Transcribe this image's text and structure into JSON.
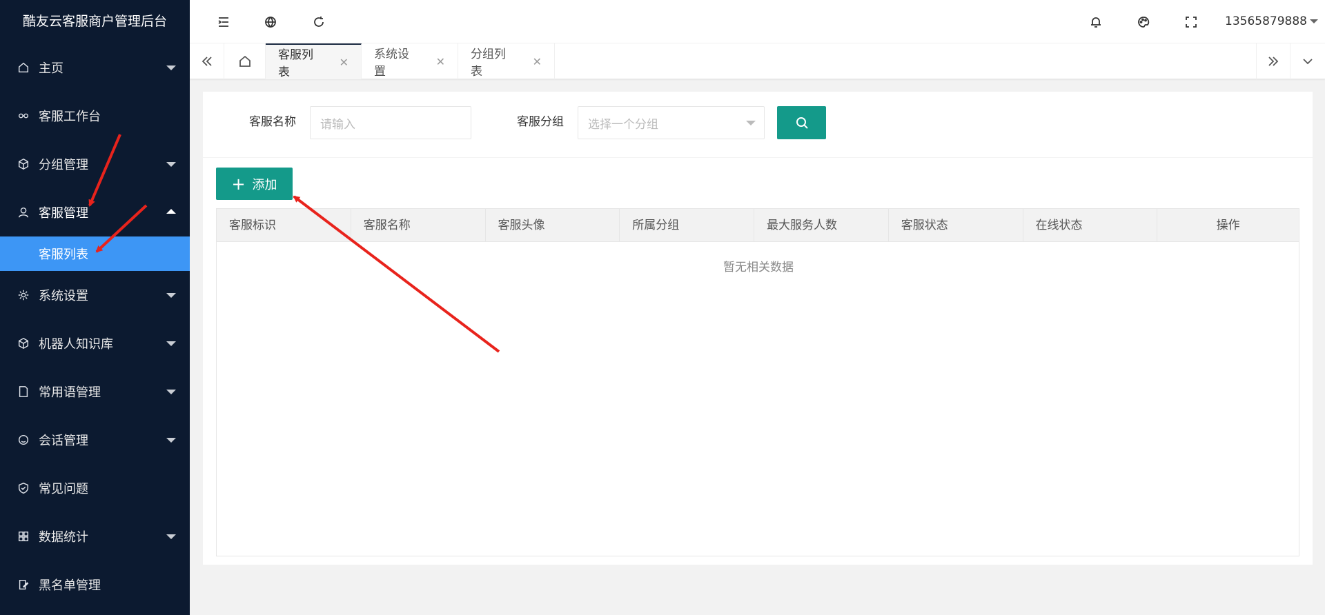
{
  "app": {
    "title": "酷友云客服商户管理后台"
  },
  "sidebar": {
    "items": [
      {
        "label": "主页",
        "icon": "home-icon",
        "caret": "down"
      },
      {
        "label": "客服工作台",
        "icon": "link-icon",
        "caret": ""
      },
      {
        "label": "分组管理",
        "icon": "cube-icon",
        "caret": "down"
      },
      {
        "label": "客服管理",
        "icon": "user-icon",
        "caret": "up"
      },
      {
        "label": "系统设置",
        "icon": "gear-icon",
        "caret": "down"
      },
      {
        "label": "机器人知识库",
        "icon": "cube-icon",
        "caret": "down"
      },
      {
        "label": "常用语管理",
        "icon": "note-icon",
        "caret": "down"
      },
      {
        "label": "会话管理",
        "icon": "smile-icon",
        "caret": "down"
      },
      {
        "label": "常见问题",
        "icon": "shield-icon",
        "caret": ""
      },
      {
        "label": "数据统计",
        "icon": "grid-icon",
        "caret": "down"
      },
      {
        "label": "黑名单管理",
        "icon": "edit-icon",
        "caret": ""
      }
    ],
    "active_sub": "客服列表"
  },
  "header": {
    "user": "13565879888"
  },
  "tabs": [
    {
      "label": "客服列表",
      "active": true
    },
    {
      "label": "系统设置",
      "active": false
    },
    {
      "label": "分组列表",
      "active": false
    }
  ],
  "filters": {
    "name_label": "客服名称",
    "name_placeholder": "请输入",
    "group_label": "客服分组",
    "group_placeholder": "选择一个分组"
  },
  "toolbar": {
    "add_label": "添加"
  },
  "table": {
    "columns": [
      "客服标识",
      "客服名称",
      "客服头像",
      "所属分组",
      "最大服务人数",
      "客服状态",
      "在线状态",
      "操作"
    ],
    "empty_text": "暂无相关数据"
  },
  "colors": {
    "accent": "#149a8a",
    "sidebar_bg": "#0c1a30",
    "sidebar_active": "#3d96f5"
  }
}
